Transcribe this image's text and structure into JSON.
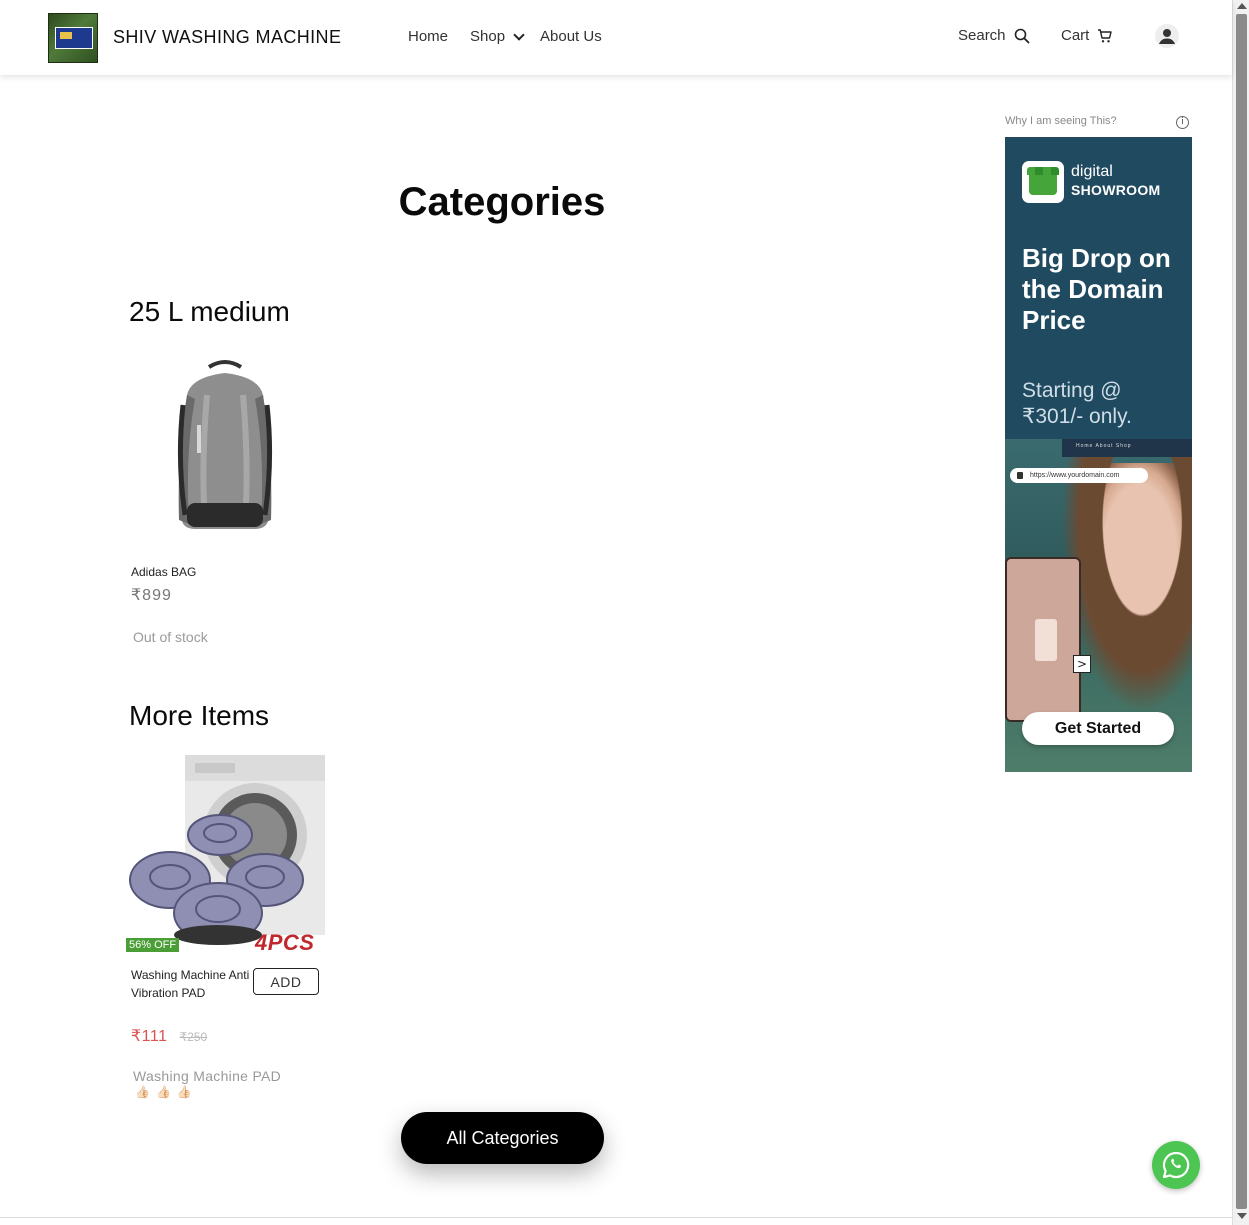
{
  "header": {
    "brand": "SHIV WASHING MACHINE",
    "nav": {
      "home": "Home",
      "shop": "Shop",
      "about": "About Us"
    },
    "search_label": "Search",
    "cart_label": "Cart"
  },
  "main": {
    "title": "Categories",
    "category": {
      "title": "25 L medium",
      "product": {
        "name": "Adidas BAG",
        "price": "₹899",
        "stock": "Out of stock"
      }
    },
    "more": {
      "title": "More Items",
      "product": {
        "badge": "56% OFF",
        "image_text": "4PCS",
        "name": "Washing Machine Anti Vibration PAD",
        "add_label": "ADD",
        "price": "₹111",
        "mrp": "₹250",
        "description": "Washing Machine PAD",
        "emoji": "👍🏻👍🏻👍🏻"
      }
    },
    "all_categories_label": "All Categories"
  },
  "ad": {
    "why_label": "Why I am seeing This?",
    "info_icon": "i",
    "brand_line1": "digital",
    "brand_line2": "SHOWROOM",
    "headline": "Big Drop on the Domain Price",
    "starting": "Starting @ ₹301/- only.",
    "browser_nav": "Home  About  Shop",
    "url": "https://www.yourdomain.com",
    "arrow": ">",
    "cta": "Get Started"
  },
  "colors": {
    "badge": "#4a9e35",
    "sale_price": "#d9534f",
    "ad_bg": "#1f4a60",
    "whatsapp": "#4cc552"
  }
}
